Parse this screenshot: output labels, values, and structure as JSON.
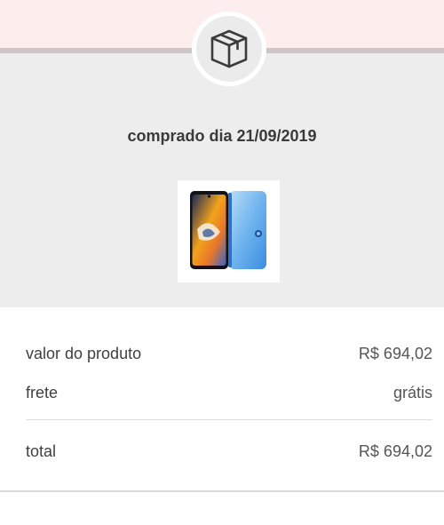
{
  "order": {
    "status_icon": "box-icon",
    "purchase_date": "comprado dia 21/09/2019",
    "product_image": "phone-product-image"
  },
  "summary": {
    "product_value_label": "valor do produto",
    "product_value": "R$ 694,02",
    "shipping_label": "frete",
    "shipping_value": "grátis",
    "total_label": "total",
    "total_value": "R$ 694,02"
  },
  "colors": {
    "top_band": "#fdeeee",
    "panel": "#ededed",
    "text": "#3f3f3f"
  }
}
